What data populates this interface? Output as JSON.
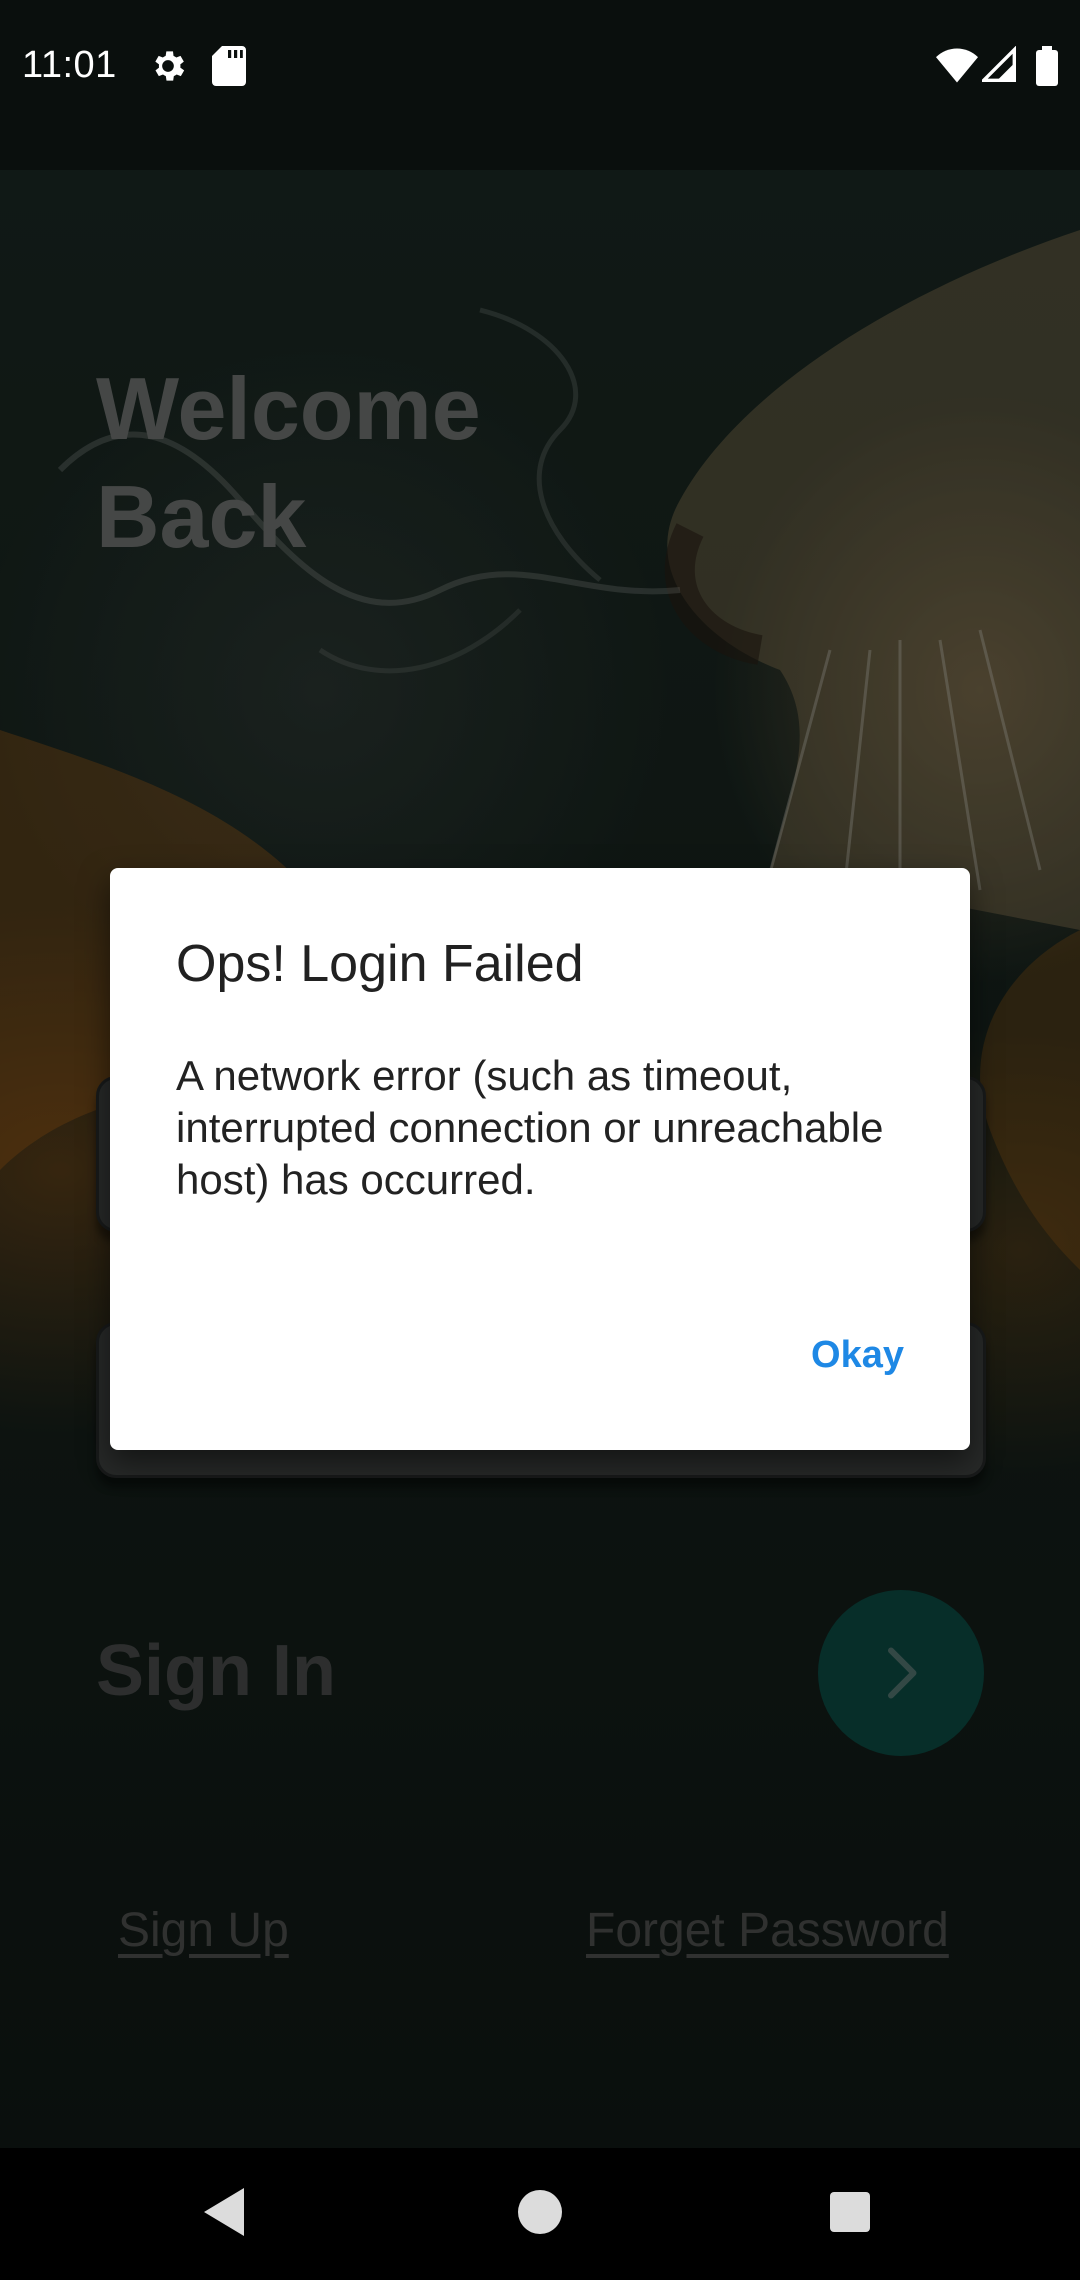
{
  "status_bar": {
    "time": "11:01",
    "icons": [
      "settings-gear-icon",
      "sd-card-icon",
      "wifi-icon",
      "cellular-signal-icon",
      "battery-icon"
    ]
  },
  "login": {
    "welcome_title": "Welcome\nBack",
    "sign_in_label": "Sign In",
    "sign_up_link": "Sign Up",
    "forget_password_link": "Forget Password",
    "go_button_icon": "chevron-right-icon",
    "accent_color": "#0b4740"
  },
  "dialog": {
    "title": "Ops! Login Failed",
    "message": "A network error (such as timeout, interrupted connection or unreachable host) has occurred.",
    "button_label": "Okay",
    "button_color": "#1e88e5"
  },
  "nav_bar": {
    "icons": [
      "back-triangle-icon",
      "home-circle-icon",
      "recents-square-icon"
    ]
  }
}
